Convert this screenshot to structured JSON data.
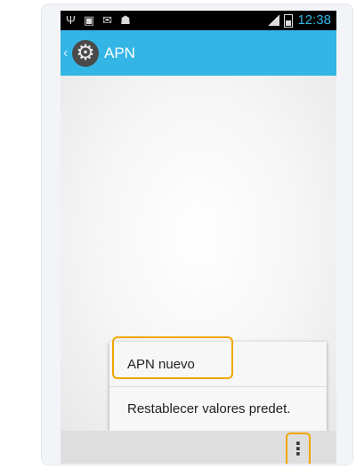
{
  "status_bar": {
    "time": "12:38",
    "icons": [
      "usb-icon",
      "image-icon",
      "mail-icon",
      "android-icon",
      "signal-icon",
      "battery-icon"
    ]
  },
  "action_bar": {
    "title": "APN",
    "icon": "settings-gear-icon",
    "accent_color": "#33b5e5"
  },
  "overflow_menu": {
    "items": [
      {
        "label": "APN nuevo"
      },
      {
        "label": "Restablecer valores predet."
      }
    ],
    "highlight_color": "#f0a500"
  },
  "bottom_bar": {
    "icon": "overflow-menu-icon"
  }
}
